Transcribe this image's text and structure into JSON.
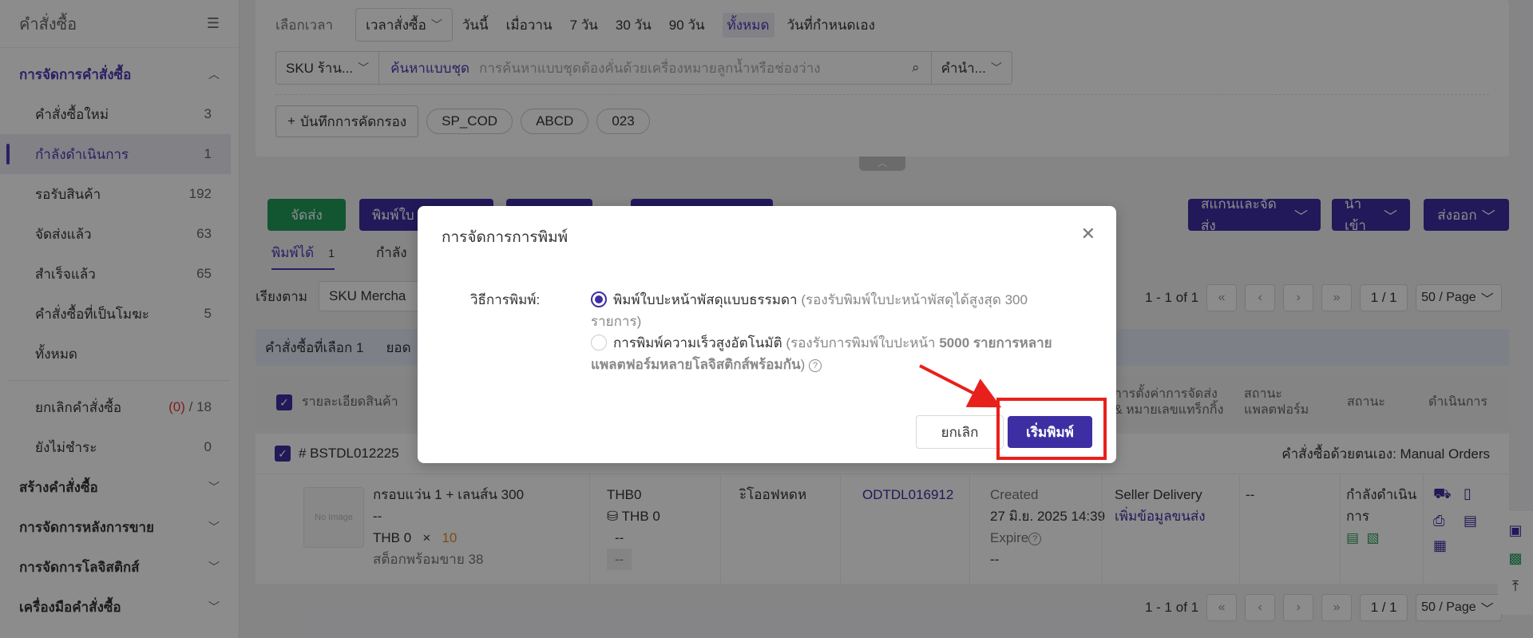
{
  "sidebar": {
    "title": "คำสั่งซื้อ",
    "group_manage": "การจัดการคำสั่งซื้อ",
    "items": [
      {
        "label": "คำสั่งซื้อใหม่",
        "count": "3"
      },
      {
        "label": "กำลังดำเนินการ",
        "count": "1"
      },
      {
        "label": "รอรับสินค้า",
        "count": "192"
      },
      {
        "label": "จัดส่งแล้ว",
        "count": "63"
      },
      {
        "label": "สำเร็จแล้ว",
        "count": "65"
      },
      {
        "label": "คำสั่งซื้อที่เป็นโมฆะ",
        "count": "5"
      },
      {
        "label": "ทั้งหมด",
        "count": ""
      }
    ],
    "cancel": {
      "label": "ยกเลิกคำสั่งซื้อ",
      "count_red": "(0)",
      "count_total": "/ 18"
    },
    "unpaid": {
      "label": "ยังไม่ชำระ",
      "count": "0"
    },
    "groups": [
      "สร้างคำสั่งซื้อ",
      "การจัดการหลังการขาย",
      "การจัดการโลจิสติกส์",
      "เครื่องมือคำสั่งซื้อ"
    ]
  },
  "filter": {
    "time_label": "เลือกเวลา",
    "time_select": "เวลาสั่งซื้อ",
    "time_options": [
      "วันนี้",
      "เมื่อวาน",
      "7 วัน",
      "30 วัน",
      "90 วัน",
      "ทั้งหมด",
      "วันที่กำหนดเอง"
    ],
    "sku_select": "SKU ร้าน...",
    "batch_search": "ค้นหาแบบชุด",
    "search_placeholder": "การค้นหาแบบชุดต้องคั่นด้วยเครื่องหมายลูกน้ำหรือช่องว่าง",
    "suffix_select": "คำนำ...",
    "save_filter": "บันทึกการคัดกรอง",
    "chips": [
      "SP_COD",
      "ABCD",
      "023"
    ]
  },
  "actions": {
    "ship": "จัดส่ง",
    "print_partial": "พิมพ์ใบ",
    "scan_ship": "สแกนและจัดส่ง",
    "import": "นำเข้า",
    "export": "ส่งออก"
  },
  "tabs": {
    "printable": "พิมพ์ได้",
    "printable_count": "1",
    "other_partial": "กำลัง"
  },
  "sort": {
    "label": "เรียงตาม",
    "value": "SKU Mercha"
  },
  "pager": {
    "range": "1 - 1 of 1",
    "page": "1 / 1",
    "size": "50 / Page"
  },
  "selection": {
    "selected": "คำสั่งซื้อที่เลือก 1",
    "total_partial": "ยอด"
  },
  "table": {
    "headers": {
      "product": "รายละเอียดสินค้า",
      "shipping": "การตั้งค่าการจัดส่ง & หมายเลขแทร็กกิ้ง",
      "platform_status": "สถานะ แพลตฟอร์ม",
      "status": "สถานะ",
      "action": "ดำเนินการ"
    },
    "order": {
      "id": "# BSTDL012225",
      "source": "คำสั่งซื้อด้วยตนเอง: Manual Orders",
      "product_name": "กรอบแว่น 1 + เลนส์น 300",
      "dash": "--",
      "price": "THB 0",
      "times": "×",
      "qty": "10",
      "stock": "สต็อกพร้อมขาย 38",
      "amount": "THB0",
      "amount2": "THB 0",
      "amount_dash": "--",
      "amount_box": "--",
      "buyer": "ะิโออฟหดห",
      "ref": "ODTDL016912",
      "created_label": "Created",
      "created_time": "27 มิ.ย. 2025 14:39",
      "expire_label": "Expire",
      "expire_val": "--",
      "ship_method": "Seller Delivery",
      "ship_link": "เพิ่มข้อมูลขนส่ง",
      "platform": "--",
      "status": "กำลังดำเนินการ",
      "no_image": "No Image"
    }
  },
  "dialog": {
    "title": "การจัดการการพิมพ์",
    "label": "วิธีการพิมพ์:",
    "option1_main": "พิมพ์ใบปะหน้าพัสดุแบบธรรมดา",
    "option1_hint": "(รองรับพิมพ์ใบปะหน้าพัสดุได้สูงสุด 300 รายการ)",
    "option2_main": "การพิมพ์ความเร็วสูงอัตโนมัติ",
    "option2_hint_a": "(รองรับการพิมพ์ใบปะหน้า",
    "option2_bold": "5000 รายการหลายแพลตฟอร์มหลายโลจิสติกส์พร้อมกัน",
    "option2_hint_b": ")",
    "cancel": "ยกเลิก",
    "start": "เริ่มพิมพ์"
  },
  "colors": {
    "accent": "#3d2fa3",
    "green": "#1f9c5a",
    "highlight": "#e8201c"
  }
}
